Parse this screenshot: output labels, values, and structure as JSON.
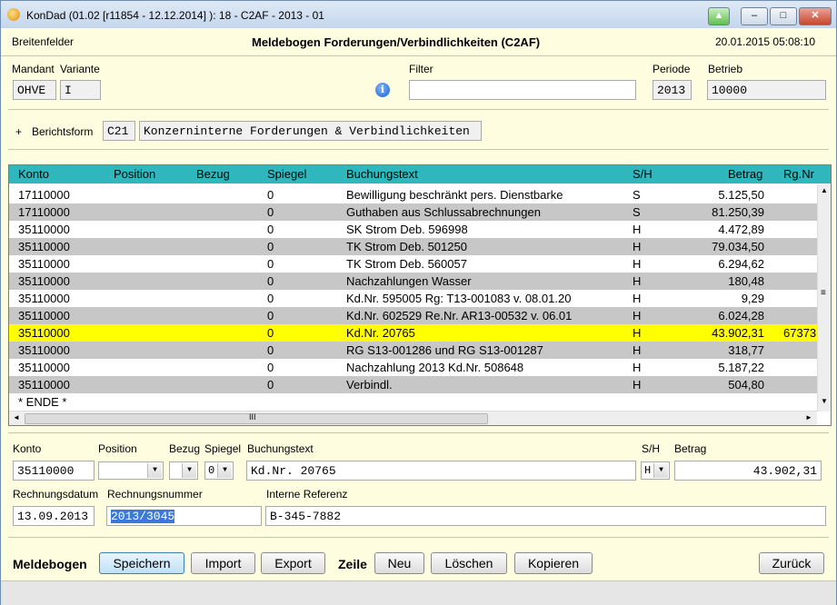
{
  "window": {
    "title": "KonDad (01.02 [r11854 - 12.12.2014] ): 18 - C2AF - 2013 - 01",
    "minimize": "–",
    "maximize": "□",
    "close": "✕",
    "extra": "▲"
  },
  "header": {
    "org": "Breitenfelder",
    "title": "Meldebogen Forderungen/Verbindlichkeiten (C2AF)",
    "datetime": "20.01.2015 05:08:10"
  },
  "filters": {
    "mandant_label": "Mandant",
    "mandant_value": "OHVE",
    "variante_label": "Variante",
    "variante_value": "I",
    "filter_label": "Filter",
    "filter_value": "",
    "periode_label": "Periode",
    "periode_value": "2013",
    "betrieb_label": "Betrieb",
    "betrieb_value": "10000",
    "info_icon": "i"
  },
  "berichtsform": {
    "expand": "+",
    "label": "Berichtsform",
    "code": "C21",
    "text": "Konzerninterne Forderungen & Verbindlichkeiten"
  },
  "grid": {
    "columns": [
      "Konto",
      "Position",
      "Bezug",
      "Spiegel",
      "Buchungstext",
      "S/H",
      "Betrag",
      "Rg.Nr"
    ],
    "rows": [
      {
        "konto": "17110000",
        "spiegel": "0",
        "text": "Bewilligung beschränkt pers. Dienstbarke",
        "sh": "S",
        "betrag": "5.125,50",
        "rg": ""
      },
      {
        "konto": "17110000",
        "spiegel": "0",
        "text": "Guthaben aus Schlussabrechnungen",
        "sh": "S",
        "betrag": "81.250,39",
        "rg": ""
      },
      {
        "konto": "35110000",
        "spiegel": "0",
        "text": "SK Strom Deb. 596998",
        "sh": "H",
        "betrag": "4.472,89",
        "rg": ""
      },
      {
        "konto": "35110000",
        "spiegel": "0",
        "text": "TK Strom Deb. 501250",
        "sh": "H",
        "betrag": "79.034,50",
        "rg": ""
      },
      {
        "konto": "35110000",
        "spiegel": "0",
        "text": "TK Strom Deb. 560057",
        "sh": "H",
        "betrag": "6.294,62",
        "rg": ""
      },
      {
        "konto": "35110000",
        "spiegel": "0",
        "text": "Nachzahlungen Wasser",
        "sh": "H",
        "betrag": "180,48",
        "rg": ""
      },
      {
        "konto": "35110000",
        "spiegel": "0",
        "text": "Kd.Nr. 595005 Rg: T13-001083 v. 08.01.20",
        "sh": "H",
        "betrag": "9,29",
        "rg": ""
      },
      {
        "konto": "35110000",
        "spiegel": "0",
        "text": "Kd.Nr. 602529 Re.Nr. AR13-00532 v. 06.01",
        "sh": "H",
        "betrag": "6.024,28",
        "rg": ""
      },
      {
        "konto": "35110000",
        "spiegel": "0",
        "text": "Kd.Nr. 20765",
        "sh": "H",
        "betrag": "43.902,31",
        "rg": "67373"
      },
      {
        "konto": "35110000",
        "spiegel": "0",
        "text": "RG S13-001286 und RG S13-001287",
        "sh": "H",
        "betrag": "318,77",
        "rg": ""
      },
      {
        "konto": "35110000",
        "spiegel": "0",
        "text": "Nachzahlung 2013 Kd.Nr. 508648",
        "sh": "H",
        "betrag": "5.187,22",
        "rg": ""
      },
      {
        "konto": "35110000",
        "spiegel": "0",
        "text": "Verbindl.",
        "sh": "H",
        "betrag": "504,80",
        "rg": ""
      }
    ],
    "end_marker": "* ENDE *",
    "scroll_up": "▲",
    "scroll_down": "▼",
    "scroll_left": "◄",
    "scroll_right": "►",
    "hscroll_grip": "III",
    "vscroll_grip": "≡"
  },
  "detail": {
    "konto_label": "Konto",
    "konto_value": "35110000",
    "position_label": "Position",
    "position_value": "",
    "bezug_label": "Bezug",
    "bezug_value": "",
    "spiegel_label": "Spiegel",
    "spiegel_value": "0",
    "buchungstext_label": "Buchungstext",
    "buchungstext_value": "Kd.Nr. 20765",
    "sh_label": "S/H",
    "sh_value": "H",
    "betrag_label": "Betrag",
    "betrag_value": "43.902,31",
    "rdatum_label": "Rechnungsdatum",
    "rdatum_value": "13.09.2013",
    "rnummer_label": "Rechnungsnummer",
    "rnummer_value": "2013/3045",
    "iref_label": "Interne Referenz",
    "iref_value": "B-345-7882",
    "arrow": "▼"
  },
  "buttons": {
    "meldebogen_label": "Meldebogen",
    "speichern": "Speichern",
    "import": "Import",
    "export": "Export",
    "zeile_label": "Zeile",
    "neu": "Neu",
    "loeschen": "Löschen",
    "kopieren": "Kopieren",
    "zurueck": "Zurück"
  }
}
